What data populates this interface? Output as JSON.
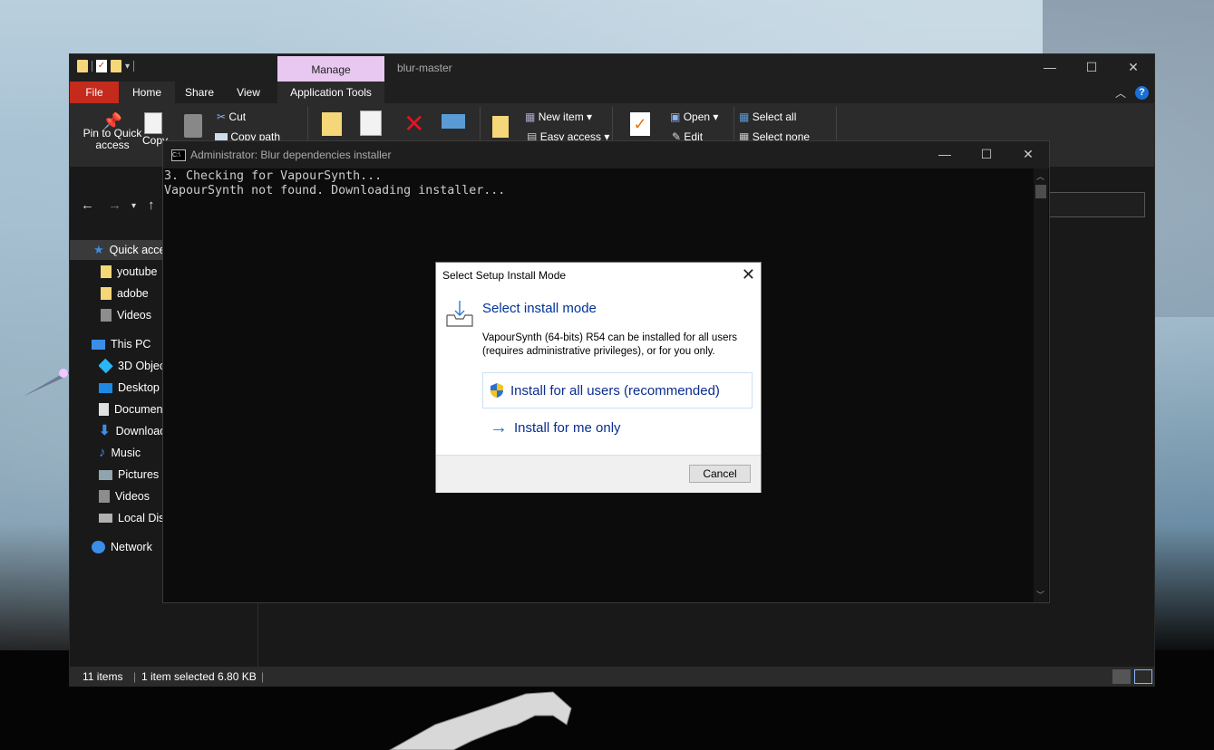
{
  "explorer": {
    "title": "blur-master",
    "manage_tab": "Manage",
    "tabs": {
      "file": "File",
      "home": "Home",
      "share": "Share",
      "view": "View",
      "app_tools": "Application Tools"
    },
    "ribbon": {
      "pin": "Pin to Quick access",
      "copy": "Copy",
      "cut": "Cut",
      "copy_path": "Copy path",
      "new_item": "New item",
      "easy_access": "Easy access",
      "open": "Open",
      "edit": "Edit",
      "select_all": "Select all",
      "select_none": "Select none"
    },
    "sidebar": [
      {
        "label": "Quick access",
        "icon": "star-icon"
      },
      {
        "label": "youtube",
        "icon": "folder-icon"
      },
      {
        "label": "adobe",
        "icon": "folder-icon"
      },
      {
        "label": "Videos",
        "icon": "videos-icon"
      },
      {
        "label": "This PC",
        "icon": "computer-icon"
      },
      {
        "label": "3D Objects",
        "icon": "cube-icon"
      },
      {
        "label": "Desktop",
        "icon": "desktop-icon"
      },
      {
        "label": "Documents",
        "icon": "document-icon"
      },
      {
        "label": "Downloads",
        "icon": "download-icon"
      },
      {
        "label": "Music",
        "icon": "music-icon"
      },
      {
        "label": "Pictures",
        "icon": "pictures-icon"
      },
      {
        "label": "Videos",
        "icon": "videos-icon"
      },
      {
        "label": "Local Disk",
        "icon": "disk-icon"
      },
      {
        "label": "Network",
        "icon": "network-icon"
      }
    ],
    "status": {
      "items": "11 items",
      "selected": "1 item selected  6.80 KB"
    }
  },
  "console": {
    "title": "Administrator:  Blur dependencies installer",
    "lines": [
      "3. Checking for VapourSynth...",
      "VapourSynth not found. Downloading installer..."
    ]
  },
  "dialog": {
    "title": "Select Setup Install Mode",
    "heading": "Select install mode",
    "text": "VapourSynth (64-bits) R54 can be installed for all users (requires administrative privileges), or for you only.",
    "option_all": "Install for all users (recommended)",
    "option_me": "Install for me only",
    "cancel": "Cancel"
  },
  "colors": {
    "accent_link": "#003399",
    "file_tab": "#c42b1c",
    "manage_tab": "#e8c8f0"
  }
}
